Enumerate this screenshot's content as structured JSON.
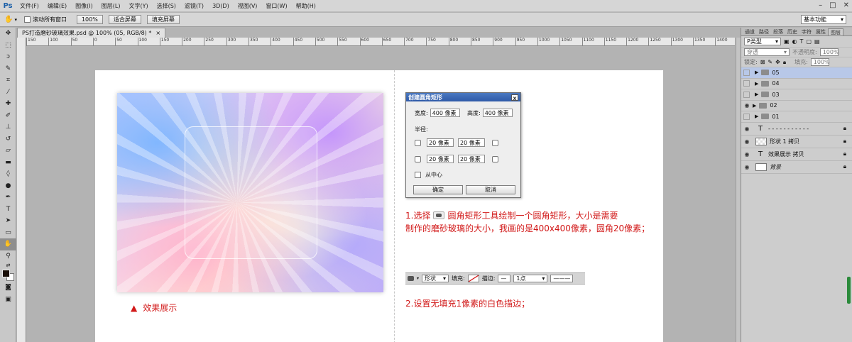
{
  "app": {
    "logo": "Ps"
  },
  "menu": [
    "文件(F)",
    "编辑(E)",
    "图像(I)",
    "图层(L)",
    "文字(Y)",
    "选择(S)",
    "滤镜(T)",
    "3D(D)",
    "视图(V)",
    "窗口(W)",
    "帮助(H)"
  ],
  "options": {
    "scroll_all_label": "滚动所有窗口",
    "zoom_value": "100%",
    "fit_screen": "适合屏幕",
    "fill_screen": "填充屏幕",
    "workspace": "基本功能"
  },
  "document": {
    "tab_title": "PS打造磨砂玻璃效果.psd @ 100% (05, RGB/8) *",
    "close": "×"
  },
  "ruler": [
    "150",
    "100",
    "50",
    "0",
    "50",
    "100",
    "150",
    "200",
    "250",
    "300",
    "350",
    "400",
    "450",
    "500",
    "550",
    "600",
    "650",
    "700",
    "750",
    "800",
    "850",
    "900",
    "950",
    "1000",
    "1050",
    "1100",
    "1150",
    "1200",
    "1250",
    "1300",
    "1350",
    "1400"
  ],
  "caption_left": {
    "marker": "▲",
    "text": "效果展示"
  },
  "dialog": {
    "title": "创建圆角矩形",
    "close": "x",
    "width_label": "宽度:",
    "width_value": "400 像素",
    "height_label": "高度:",
    "height_value": "400 像素",
    "radius_label": "半径:",
    "r1": "20 像素",
    "r2": "20 像素",
    "r3": "20 像素",
    "r4": "20 像素",
    "from_center": "从中心",
    "ok": "确定",
    "cancel": "取消"
  },
  "steps": {
    "step1_a": "1.选择",
    "step1_b": "圆角矩形工具绘制一个圆角矩形，大小是需要",
    "step1_c": "制作的磨砂玻璃的大小，我画的是400x400像素，圆角20像素；",
    "step2": "2.设置无填充1像素的白色描边；"
  },
  "shape_bar": {
    "mode": "形状",
    "fill_label": "填充:",
    "stroke_label": "描边:",
    "stroke_size": "1点"
  },
  "panel": {
    "tabs": [
      "通道",
      "路径",
      "段落",
      "历史",
      "字符",
      "属性",
      "图层"
    ],
    "filter_kind": "P类型",
    "blend": "穿透",
    "opacity_label": "不透明度:",
    "opacity_value": "100%",
    "lock_label": "锁定:",
    "fill_label": "填充:",
    "fill_value": "100%",
    "layers": [
      {
        "name": "05",
        "type": "folder",
        "visible": false,
        "selected": true
      },
      {
        "name": "04",
        "type": "folder",
        "visible": false,
        "selected": false
      },
      {
        "name": "03",
        "type": "folder",
        "visible": false,
        "selected": false
      },
      {
        "name": "02",
        "type": "folder",
        "visible": true,
        "selected": false
      },
      {
        "name": "01",
        "type": "folder",
        "visible": false,
        "selected": false
      },
      {
        "name": "- - - - - - - - - - -",
        "type": "text",
        "visible": true,
        "selected": false
      },
      {
        "name": "形状 1 拷贝",
        "type": "shape",
        "visible": true,
        "selected": false
      },
      {
        "name": "效果展示 拷贝",
        "type": "text",
        "visible": true,
        "selected": false
      },
      {
        "name": "背景",
        "type": "bg",
        "visible": true,
        "selected": false
      }
    ]
  }
}
